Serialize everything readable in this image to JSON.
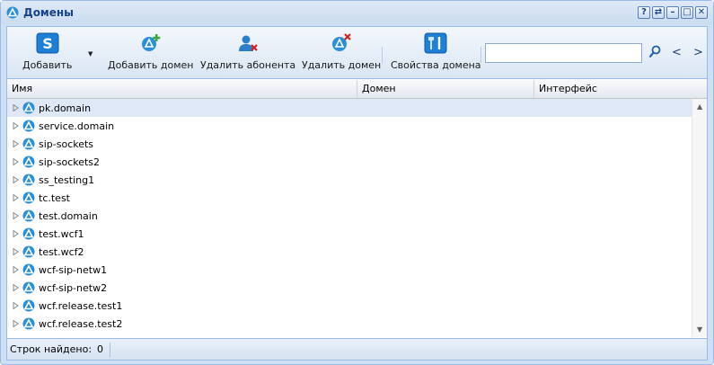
{
  "window": {
    "title": "Домены",
    "tools": [
      "?",
      "⇄",
      "–",
      "□",
      "✕"
    ]
  },
  "toolbar": {
    "add_label": "Добавить",
    "add_domain_label": "Добавить домен",
    "delete_subscriber_label": "Удалить абонента",
    "delete_domain_label": "Удалить домен",
    "domain_properties_label": "Свойства домена",
    "search_value": "",
    "prev_glyph": "<",
    "next_glyph": ">"
  },
  "columns": [
    "Имя",
    "Домен",
    "Интерфейс"
  ],
  "rows": [
    {
      "name": "pk.domain",
      "domain": "",
      "interface": ""
    },
    {
      "name": "service.domain",
      "domain": "",
      "interface": ""
    },
    {
      "name": "sip-sockets",
      "domain": "",
      "interface": ""
    },
    {
      "name": "sip-sockets2",
      "domain": "",
      "interface": ""
    },
    {
      "name": "ss_testing1",
      "domain": "",
      "interface": ""
    },
    {
      "name": "tc.test",
      "domain": "",
      "interface": ""
    },
    {
      "name": "test.domain",
      "domain": "",
      "interface": ""
    },
    {
      "name": "test.wcf1",
      "domain": "",
      "interface": ""
    },
    {
      "name": "test.wcf2",
      "domain": "",
      "interface": ""
    },
    {
      "name": "wcf-sip-netw1",
      "domain": "",
      "interface": ""
    },
    {
      "name": "wcf-sip-netw2",
      "domain": "",
      "interface": ""
    },
    {
      "name": "wcf.release.test1",
      "domain": "",
      "interface": ""
    },
    {
      "name": "wcf.release.test2",
      "domain": "",
      "interface": ""
    }
  ],
  "status": {
    "rows_found_label": "Строк найдено:",
    "rows_found_value": "0"
  },
  "colors": {
    "accent": "#15428b",
    "selection": "#dfe8f6",
    "border": "#99bbe8",
    "icon_blue": "#2a8fd8"
  }
}
